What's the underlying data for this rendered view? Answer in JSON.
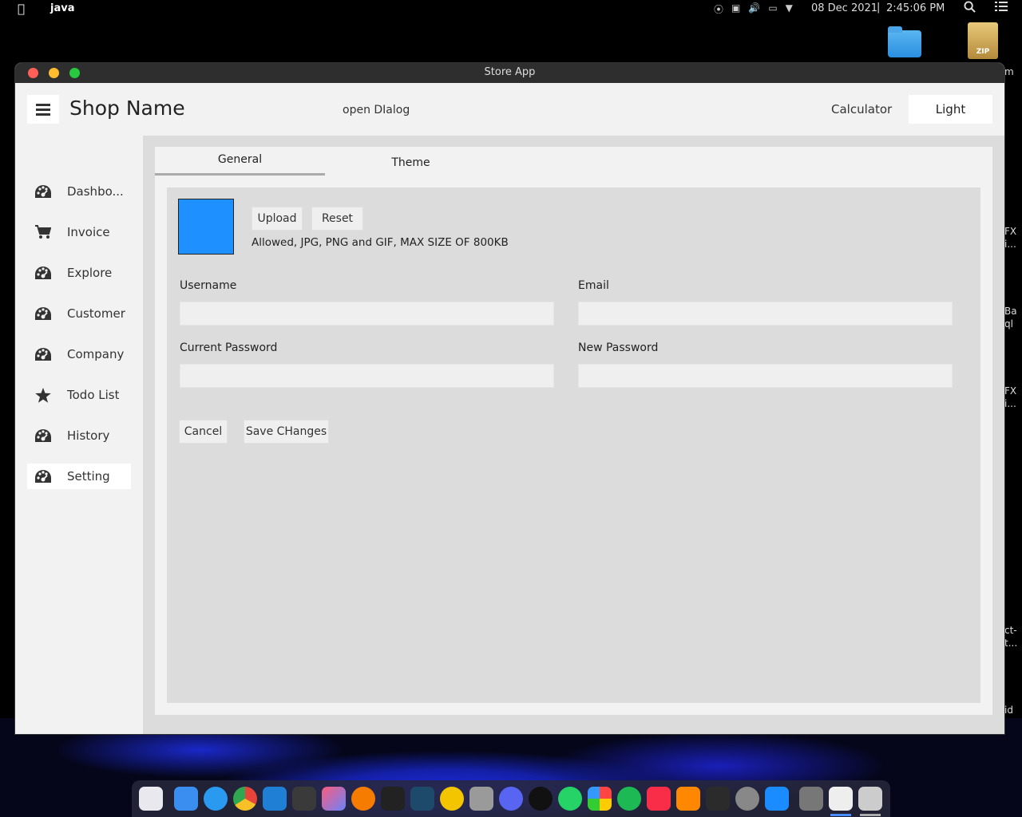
{
  "menubar": {
    "app_name": "java",
    "date": "08 Dec 2021",
    "separator": "|",
    "time": "2:45:06 PM"
  },
  "desktop": {
    "zip_label": "ZIP",
    "edge_texts": [
      "m",
      "FX",
      "i...",
      "Ba",
      "ql",
      "FX",
      "i...",
      "ct-",
      "t...",
      "id"
    ]
  },
  "window": {
    "title": "Store App"
  },
  "header": {
    "shop_name": "Shop Name",
    "open_dialog": "open DIalog",
    "calculator": "Calculator",
    "theme_button": "Light"
  },
  "sidebar": {
    "items": [
      {
        "label": "Dashbo...",
        "icon": "dashboard-icon"
      },
      {
        "label": "Invoice",
        "icon": "cart-icon"
      },
      {
        "label": "Explore",
        "icon": "dashboard-icon"
      },
      {
        "label": "Customer",
        "icon": "dashboard-icon"
      },
      {
        "label": "Company",
        "icon": "dashboard-icon"
      },
      {
        "label": "Todo List",
        "icon": "star-icon"
      },
      {
        "label": "History",
        "icon": "dashboard-icon"
      },
      {
        "label": "Setting",
        "icon": "dashboard-icon",
        "active": true
      }
    ]
  },
  "tabs": {
    "general": "General",
    "theme": "Theme"
  },
  "profile": {
    "avatar_color": "#1e90ff",
    "upload": "Upload",
    "reset": "Reset",
    "allowed_text": "Allowed, JPG, PNG and GIF, MAX SIZE OF 800KB"
  },
  "form": {
    "username_label": "Username",
    "username_value": "",
    "email_label": "Email",
    "email_value": "",
    "current_password_label": "Current Password",
    "current_password_value": "",
    "new_password_label": "New Password",
    "new_password_value": "",
    "cancel": "Cancel",
    "save": "Save CHanges"
  },
  "dock": {
    "apps": [
      "launchpad",
      "finder",
      "safari",
      "chrome",
      "vscode",
      "sublime",
      "intellij",
      "postman",
      "terminal-code",
      "mysql-workbench",
      "bitwarden",
      "database",
      "discord",
      "github",
      "whatsapp",
      "photos",
      "spotify",
      "music",
      "vlc",
      "terminal",
      "system-preferences",
      "app-store",
      "trash",
      "xquartz",
      "screenshot"
    ]
  }
}
